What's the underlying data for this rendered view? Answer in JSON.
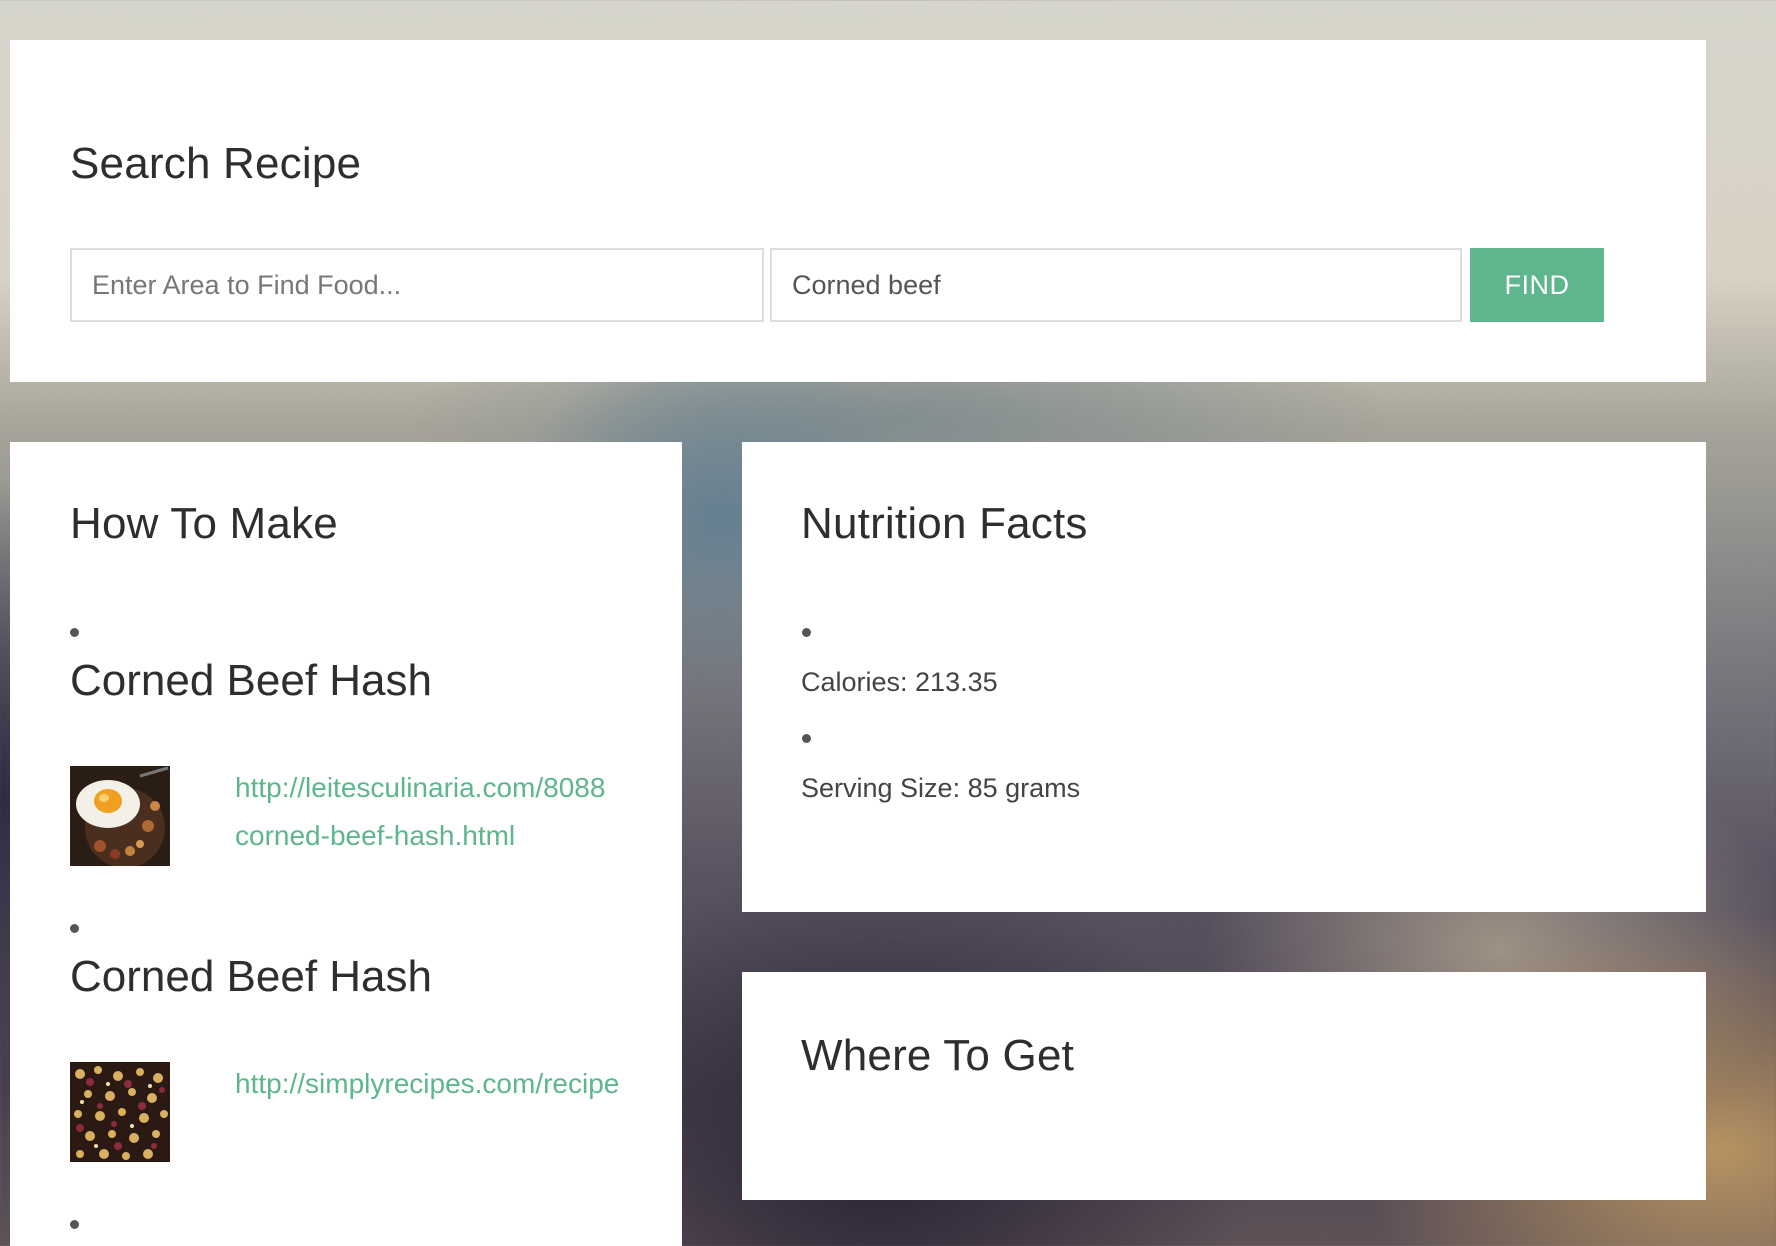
{
  "search": {
    "title": "Search Recipe",
    "area_placeholder": "Enter Area to Find Food...",
    "area_value": "",
    "food_value": "Corned beef",
    "find_label": "FIND"
  },
  "how_to_make": {
    "title": "How To Make",
    "recipes": [
      {
        "title": "Corned Beef Hash",
        "image": "fried-egg-hash-photo",
        "link_line1": "http://leitesculinaria.com/8088",
        "link_line2": "corned-beef-hash.html"
      },
      {
        "title": "Corned Beef Hash",
        "image": "skillet-hash-photo",
        "link_line1": "http://simplyrecipes.com/recipe",
        "link_line2": ""
      }
    ]
  },
  "nutrition": {
    "title": "Nutrition Facts",
    "facts": [
      "Calories: 213.35",
      "Serving Size: 85 grams"
    ]
  },
  "where_to_get": {
    "title": "Where To Get"
  },
  "colors": {
    "accent": "#5eb68d",
    "card": "#ffffff",
    "text": "#2e2e2e"
  }
}
